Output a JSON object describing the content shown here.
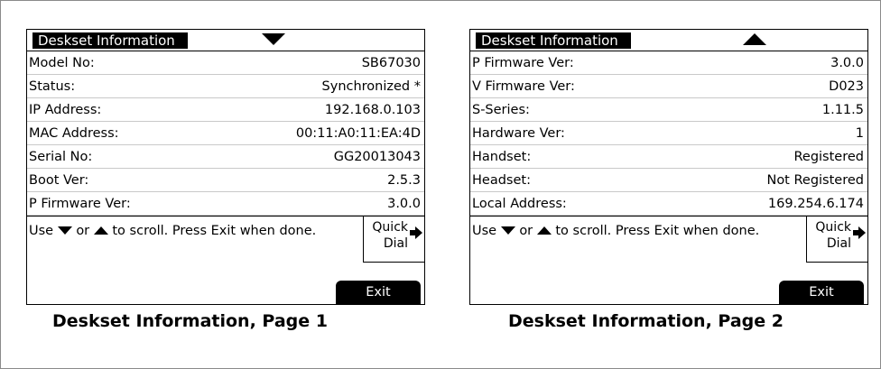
{
  "panels": [
    {
      "title": "Deskset Information",
      "scroll_arrow": "down-triangle-icon",
      "rows": [
        {
          "label": "Model No:",
          "value": "SB67030"
        },
        {
          "label": "Status:",
          "value": "Synchronized *"
        },
        {
          "label": "IP Address:",
          "value": "192.168.0.103"
        },
        {
          "label": "MAC Address:",
          "value": "00:11:A0:11:EA:4D"
        },
        {
          "label": "Serial No:",
          "value": "GG20013043"
        },
        {
          "label": "Boot Ver:",
          "value": "2.5.3"
        },
        {
          "label": "P Firmware Ver:",
          "value": "3.0.0"
        }
      ],
      "hint_prefix": "Use",
      "hint_or": "or",
      "hint_suffix": "to scroll. Press Exit when done.",
      "quick_dial_line1": "Quick",
      "quick_dial_line2": "Dial",
      "exit_label": "Exit",
      "caption": "Deskset Information, Page 1"
    },
    {
      "title": "Deskset Information",
      "scroll_arrow": "up-triangle-icon",
      "rows": [
        {
          "label": "P Firmware Ver:",
          "value": "3.0.0"
        },
        {
          "label": "V Firmware Ver:",
          "value": "D023"
        },
        {
          "label": "S-Series:",
          "value": "1.11.5"
        },
        {
          "label": "Hardware Ver:",
          "value": "1"
        },
        {
          "label": "Handset:",
          "value": "Registered"
        },
        {
          "label": "Headset:",
          "value": "Not Registered"
        },
        {
          "label": "Local Address:",
          "value": "169.254.6.174"
        }
      ],
      "hint_prefix": "Use",
      "hint_or": "or",
      "hint_suffix": "to scroll. Press Exit when done.",
      "quick_dial_line1": "Quick",
      "quick_dial_line2": "Dial",
      "exit_label": "Exit",
      "caption": "Deskset Information, Page 2"
    }
  ]
}
